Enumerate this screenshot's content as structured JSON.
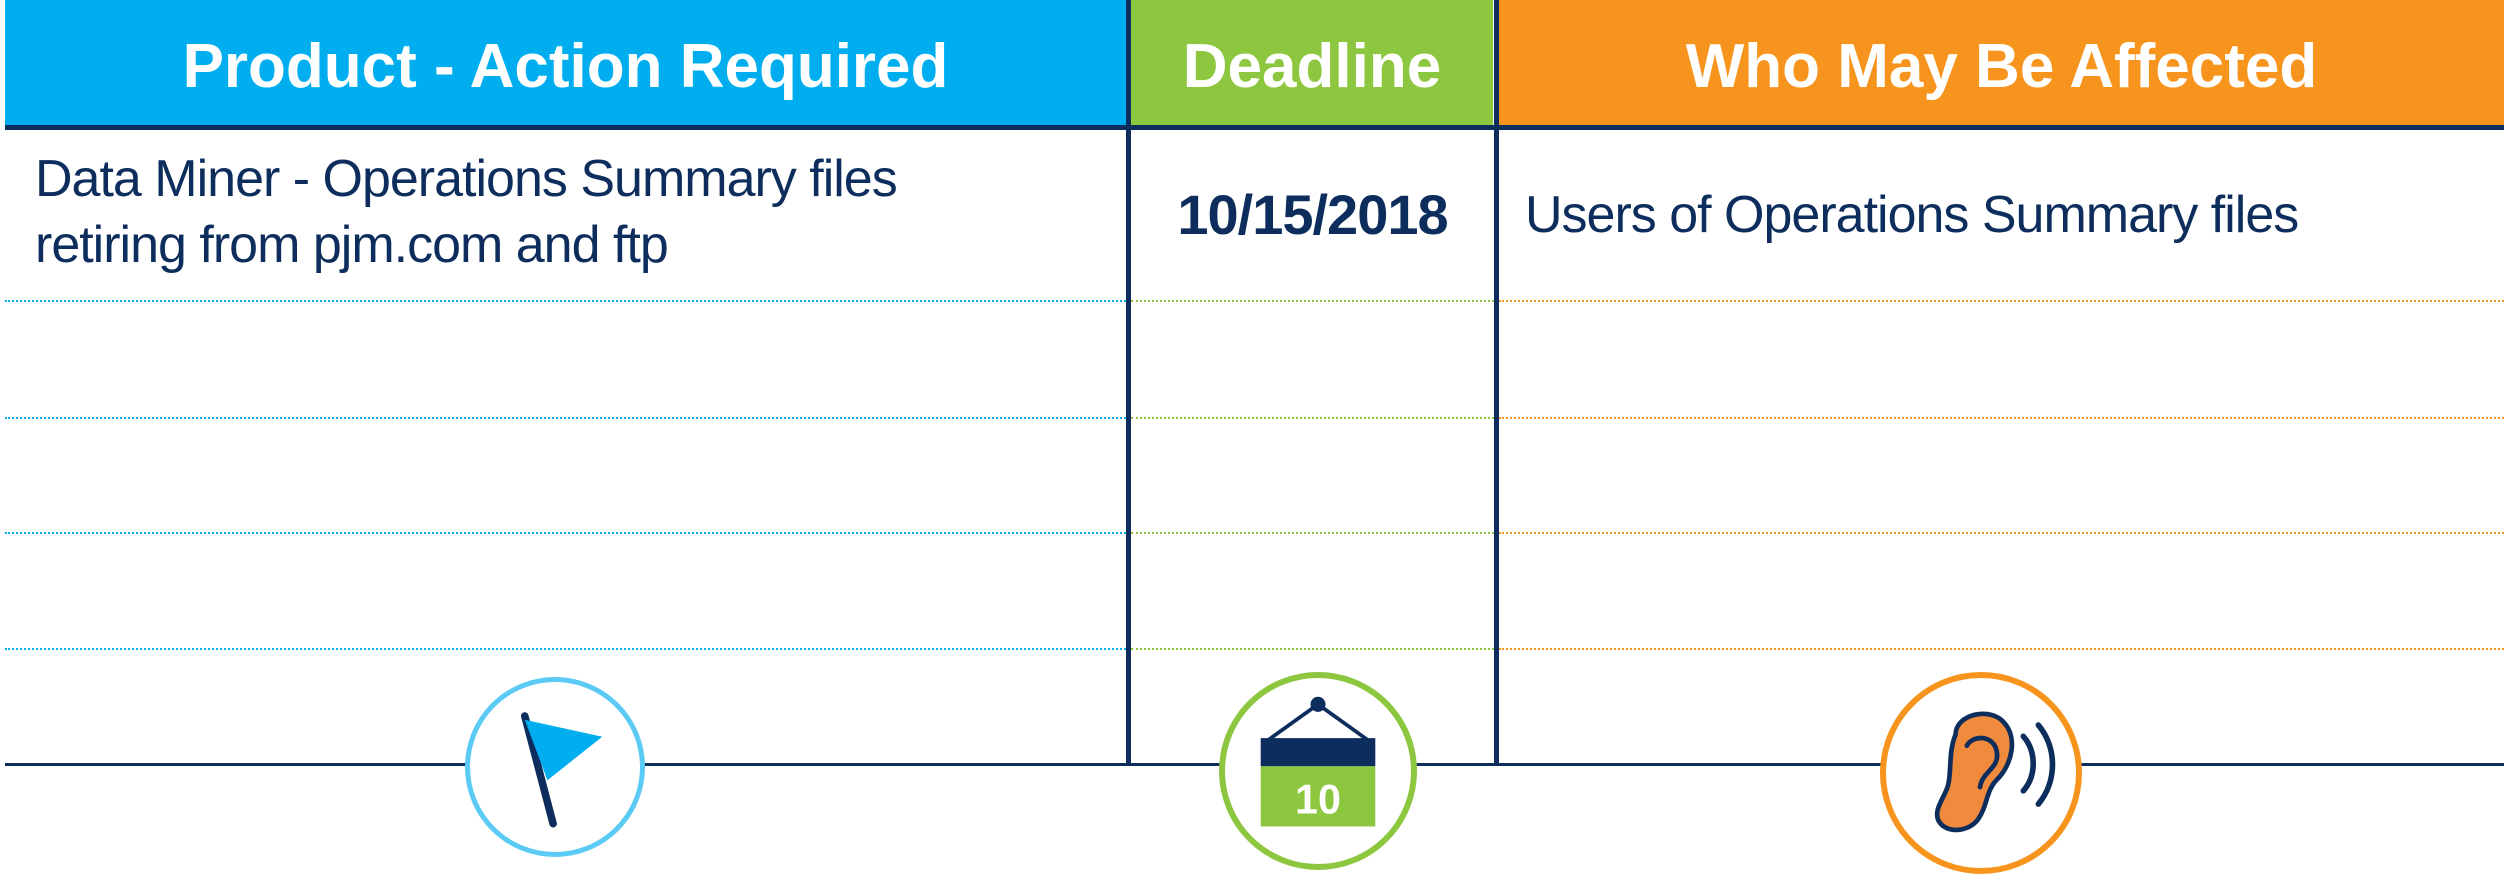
{
  "headers": {
    "product": "Product - Action Required",
    "deadline": "Deadline",
    "affected": "Who May Be Affected"
  },
  "rows": [
    {
      "product_line1": "Data Miner - Operations Summary files",
      "product_line2": "retiring from pjm.com and ftp",
      "deadline": "10/15/2018",
      "affected": "Users of Operations Summary files"
    }
  ],
  "icons": {
    "product": "flag-icon",
    "deadline": "calendar-icon",
    "deadline_calendar_day": "10",
    "affected": "ear-listening-icon"
  },
  "colors": {
    "product": "#00aeef",
    "deadline": "#8dc63f",
    "affected": "#f7941d",
    "text": "#0d2d5c"
  }
}
